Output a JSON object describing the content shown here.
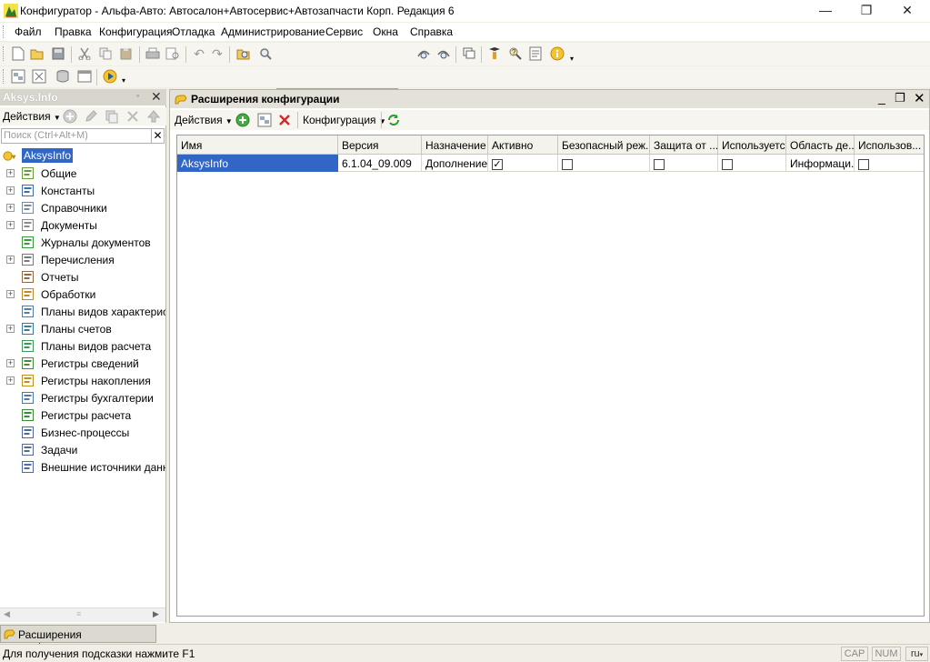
{
  "window": {
    "title": "Конфигуратор - Альфа-Авто: Автосалон+Автосервис+Автозапчасти Корп. Редакция 6",
    "minimize": "—",
    "restore": "❐",
    "close": "✕"
  },
  "menu": [
    "Файл",
    "Правка",
    "Конфигурация",
    "Отладка",
    "Администрирование",
    "Сервис",
    "Окна",
    "Справка"
  ],
  "toolbar": {
    "search_value": ""
  },
  "left_panel": {
    "title": "Aksys.Info",
    "actions_label": "Действия",
    "search_placeholder": "Поиск (Ctrl+Alt+M)",
    "root": "AksysInfo",
    "items": [
      {
        "label": "Общие",
        "icon": "common-icon"
      },
      {
        "label": "Константы",
        "icon": "constants-icon"
      },
      {
        "label": "Справочники",
        "icon": "catalogs-icon"
      },
      {
        "label": "Документы",
        "icon": "documents-icon"
      },
      {
        "label": "Журналы документов",
        "icon": "journals-icon"
      },
      {
        "label": "Перечисления",
        "icon": "enums-icon"
      },
      {
        "label": "Отчеты",
        "icon": "reports-icon"
      },
      {
        "label": "Обработки",
        "icon": "dataprocessors-icon"
      },
      {
        "label": "Планы видов характеристик",
        "icon": "chart-char-types-icon"
      },
      {
        "label": "Планы счетов",
        "icon": "chart-accounts-icon"
      },
      {
        "label": "Планы видов расчета",
        "icon": "chart-calc-types-icon"
      },
      {
        "label": "Регистры сведений",
        "icon": "info-registers-icon"
      },
      {
        "label": "Регистры накопления",
        "icon": "accum-registers-icon"
      },
      {
        "label": "Регистры бухгалтерии",
        "icon": "accounting-registers-icon"
      },
      {
        "label": "Регистры расчета",
        "icon": "calc-registers-icon"
      },
      {
        "label": "Бизнес-процессы",
        "icon": "business-processes-icon"
      },
      {
        "label": "Задачи",
        "icon": "tasks-icon"
      },
      {
        "label": "Внешние источники данных",
        "icon": "external-sources-icon"
      }
    ]
  },
  "extensions_window": {
    "title": "Расширения конфигурации",
    "actions_label": "Действия",
    "config_label": "Конфигурация",
    "columns": [
      "Имя",
      "Версия",
      "Назначение",
      "Активно",
      "Безопасный реж...",
      "Защита от ...",
      "Используется...",
      "Область де...",
      "Использов..."
    ],
    "rows": [
      {
        "name": "AksysInfo",
        "version": "6.1.04_09.009",
        "purpose": "Дополнение",
        "active": true,
        "safe_mode": false,
        "protection": false,
        "used": false,
        "scope": "Информаци...",
        "use2": false
      }
    ]
  },
  "taskbar": {
    "tab_label": "Расширения конфигурации"
  },
  "status": {
    "hint": "Для получения подсказки нажмите F1",
    "cap": "CAP",
    "num": "NUM",
    "lang": "ru"
  }
}
